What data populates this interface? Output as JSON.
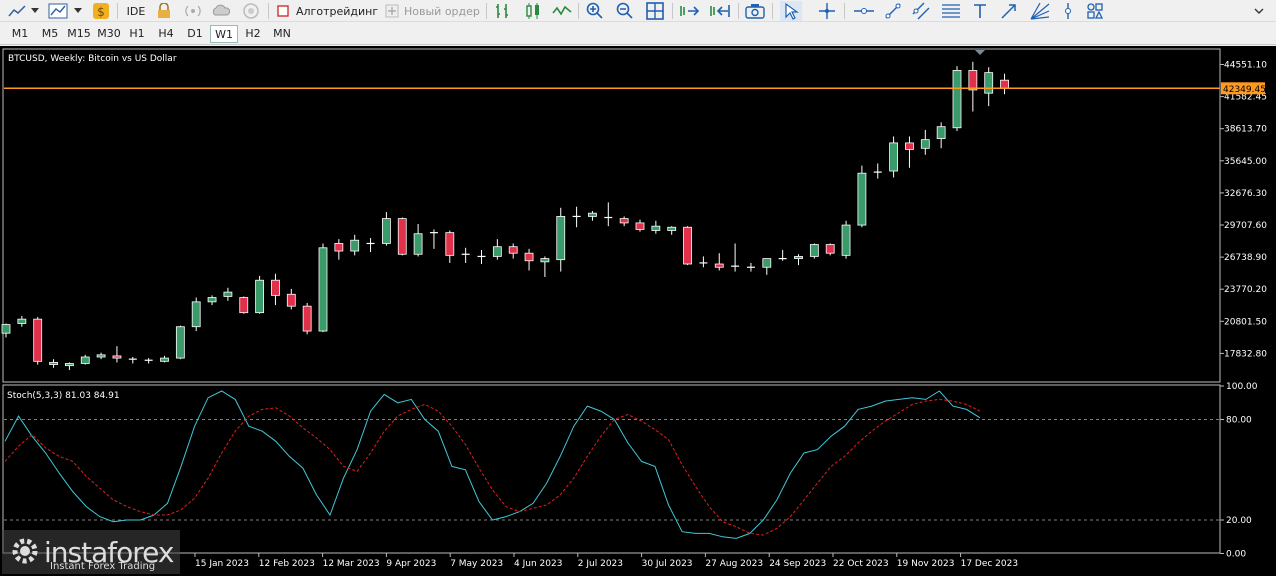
{
  "toolbar": {
    "ide_label": "IDE",
    "algotrading_label": "Алготрейдинг",
    "new_order_label": "Новый ордер"
  },
  "timeframes": [
    {
      "label": "M1",
      "active": false
    },
    {
      "label": "M5",
      "active": false
    },
    {
      "label": "M15",
      "active": false
    },
    {
      "label": "M30",
      "active": false
    },
    {
      "label": "H1",
      "active": false
    },
    {
      "label": "H4",
      "active": false
    },
    {
      "label": "D1",
      "active": false
    },
    {
      "label": "W1",
      "active": true
    },
    {
      "label": "H2",
      "active": false
    },
    {
      "label": "MN",
      "active": false
    }
  ],
  "main_chart": {
    "title": "BTCUSD, Weekly:  Bitcoin vs US Dollar",
    "current_price": "42349.45",
    "current_price_value": 42349.45,
    "price_labels": [
      "44551.10",
      "41582.45",
      "38613.70",
      "35645.00",
      "32676.30",
      "29707.60",
      "26738.90",
      "23770.20",
      "20801.50",
      "17832.80"
    ],
    "colors": {
      "bull": "#3a9a6a",
      "bear": "#e0304a",
      "price_line": "#ff9a20",
      "background": "#000000"
    }
  },
  "indicator": {
    "title": "Stoch(5,3,3) 81.03 84.91",
    "levels": [
      "100.00",
      "80.00",
      "20.00",
      "0.00"
    ],
    "colors": {
      "k_line": "#40c8d8",
      "d_line": "#e02020"
    }
  },
  "time_labels": [
    "15 Jan 2023",
    "12 Feb 2023",
    "12 Mar 2023",
    "9 Apr 2023",
    "7 May 2023",
    "4 Jun 2023",
    "2 Jul 2023",
    "30 Jul 2023",
    "27 Aug 2023",
    "24 Sep 2023",
    "22 Oct 2023",
    "19 Nov 2023",
    "17 Dec 2023"
  ],
  "watermark": {
    "brand": "instaforex",
    "tagline": "Instant Forex Trading"
  },
  "chart_data": {
    "type": "candlestick",
    "title": "BTCUSD, Weekly:  Bitcoin vs US Dollar",
    "series": [
      {
        "name": "BTCUSD",
        "candles": [
          {
            "o": 19700,
            "h": 20600,
            "l": 19300,
            "c": 20500
          },
          {
            "o": 20600,
            "h": 21300,
            "l": 20300,
            "c": 21000
          },
          {
            "o": 21000,
            "h": 21200,
            "l": 16800,
            "c": 17100
          },
          {
            "o": 16800,
            "h": 17300,
            "l": 16500,
            "c": 17000
          },
          {
            "o": 16700,
            "h": 17000,
            "l": 16300,
            "c": 16900
          },
          {
            "o": 16900,
            "h": 17700,
            "l": 16800,
            "c": 17500
          },
          {
            "o": 17500,
            "h": 17900,
            "l": 17300,
            "c": 17700
          },
          {
            "o": 17600,
            "h": 18500,
            "l": 17000,
            "c": 17400
          },
          {
            "o": 17200,
            "h": 17500,
            "l": 16900,
            "c": 17300
          },
          {
            "o": 17200,
            "h": 17400,
            "l": 16900,
            "c": 17100
          },
          {
            "o": 17100,
            "h": 17600,
            "l": 17000,
            "c": 17400
          },
          {
            "o": 17400,
            "h": 20400,
            "l": 17300,
            "c": 20300
          },
          {
            "o": 20300,
            "h": 23000,
            "l": 19900,
            "c": 22600
          },
          {
            "o": 22600,
            "h": 23200,
            "l": 22300,
            "c": 23000
          },
          {
            "o": 23100,
            "h": 23900,
            "l": 22700,
            "c": 23500
          },
          {
            "o": 23000,
            "h": 23100,
            "l": 21500,
            "c": 21600
          },
          {
            "o": 21600,
            "h": 25000,
            "l": 21500,
            "c": 24600
          },
          {
            "o": 24600,
            "h": 25200,
            "l": 22300,
            "c": 23200
          },
          {
            "o": 23300,
            "h": 23800,
            "l": 21900,
            "c": 22200
          },
          {
            "o": 22200,
            "h": 22500,
            "l": 19600,
            "c": 19900
          },
          {
            "o": 19900,
            "h": 28000,
            "l": 19800,
            "c": 27600
          },
          {
            "o": 28000,
            "h": 28400,
            "l": 26500,
            "c": 27300
          },
          {
            "o": 27300,
            "h": 28800,
            "l": 26900,
            "c": 28300
          },
          {
            "o": 27900,
            "h": 28500,
            "l": 27200,
            "c": 28000
          },
          {
            "o": 28000,
            "h": 30900,
            "l": 27800,
            "c": 30300
          },
          {
            "o": 30300,
            "h": 30400,
            "l": 26900,
            "c": 27000
          },
          {
            "o": 27000,
            "h": 29800,
            "l": 26800,
            "c": 28900
          },
          {
            "o": 28900,
            "h": 29300,
            "l": 27500,
            "c": 29000
          },
          {
            "o": 29000,
            "h": 29200,
            "l": 26200,
            "c": 26900
          },
          {
            "o": 26900,
            "h": 27600,
            "l": 26200,
            "c": 27000
          },
          {
            "o": 26700,
            "h": 27400,
            "l": 26100,
            "c": 26800
          },
          {
            "o": 26800,
            "h": 28400,
            "l": 26500,
            "c": 27700
          },
          {
            "o": 27700,
            "h": 28000,
            "l": 26600,
            "c": 27100
          },
          {
            "o": 27100,
            "h": 27500,
            "l": 25500,
            "c": 26400
          },
          {
            "o": 26300,
            "h": 26800,
            "l": 24900,
            "c": 26600
          },
          {
            "o": 26500,
            "h": 31300,
            "l": 25400,
            "c": 30500
          },
          {
            "o": 30500,
            "h": 31400,
            "l": 29500,
            "c": 30500
          },
          {
            "o": 30500,
            "h": 31000,
            "l": 30100,
            "c": 30800
          },
          {
            "o": 30400,
            "h": 31800,
            "l": 29600,
            "c": 30300
          },
          {
            "o": 30300,
            "h": 30500,
            "l": 29600,
            "c": 29900
          },
          {
            "o": 29900,
            "h": 30200,
            "l": 29100,
            "c": 29300
          },
          {
            "o": 29200,
            "h": 30100,
            "l": 28900,
            "c": 29600
          },
          {
            "o": 29200,
            "h": 29600,
            "l": 28800,
            "c": 29500
          },
          {
            "o": 29500,
            "h": 29600,
            "l": 26000,
            "c": 26100
          },
          {
            "o": 26100,
            "h": 26800,
            "l": 25800,
            "c": 26200
          },
          {
            "o": 26100,
            "h": 27100,
            "l": 25500,
            "c": 25800
          },
          {
            "o": 25800,
            "h": 28000,
            "l": 25400,
            "c": 25900
          },
          {
            "o": 25700,
            "h": 26200,
            "l": 25400,
            "c": 25800
          },
          {
            "o": 25800,
            "h": 26600,
            "l": 25100,
            "c": 26600
          },
          {
            "o": 26500,
            "h": 27400,
            "l": 26400,
            "c": 26600
          },
          {
            "o": 26600,
            "h": 27000,
            "l": 26000,
            "c": 26800
          },
          {
            "o": 26800,
            "h": 28000,
            "l": 26600,
            "c": 27900
          },
          {
            "o": 27900,
            "h": 28000,
            "l": 26900,
            "c": 27100
          },
          {
            "o": 26900,
            "h": 30100,
            "l": 26600,
            "c": 29700
          },
          {
            "o": 29700,
            "h": 35200,
            "l": 29500,
            "c": 34500
          },
          {
            "o": 34500,
            "h": 35400,
            "l": 34000,
            "c": 34600
          },
          {
            "o": 34700,
            "h": 37900,
            "l": 34100,
            "c": 37300
          },
          {
            "o": 37300,
            "h": 37900,
            "l": 35000,
            "c": 36700
          },
          {
            "o": 36800,
            "h": 38500,
            "l": 36200,
            "c": 37600
          },
          {
            "o": 37700,
            "h": 39200,
            "l": 36800,
            "c": 38800
          },
          {
            "o": 38700,
            "h": 44400,
            "l": 38400,
            "c": 44000
          },
          {
            "o": 44000,
            "h": 44800,
            "l": 40200,
            "c": 42200
          },
          {
            "o": 41900,
            "h": 44300,
            "l": 40700,
            "c": 43800
          },
          {
            "o": 43100,
            "h": 43700,
            "l": 41800,
            "c": 42349.45
          }
        ]
      }
    ],
    "stochastic": {
      "name": "Stoch(5,3,3)",
      "k_last": 81.03,
      "d_last": 84.91,
      "levels": [
        20,
        80
      ],
      "ylim": [
        0,
        100
      ],
      "k": [
        67,
        82,
        70,
        60,
        48,
        37,
        28,
        22,
        19,
        20,
        20,
        23,
        30,
        52,
        76,
        93,
        97,
        92,
        76,
        73,
        67,
        58,
        51,
        35,
        23,
        45,
        62,
        85,
        95,
        90,
        92,
        80,
        73,
        52,
        50,
        31,
        20,
        22,
        25,
        30,
        42,
        58,
        76,
        88,
        85,
        80,
        66,
        55,
        52,
        29,
        13,
        12,
        12,
        10,
        9,
        12,
        20,
        32,
        48,
        60,
        62,
        70,
        76,
        86,
        88,
        91,
        92,
        93,
        92,
        97,
        88,
        86,
        81
      ],
      "d": [
        55,
        64,
        71,
        63,
        58,
        55,
        46,
        39,
        32,
        28,
        25,
        23,
        23,
        26,
        33,
        45,
        60,
        73,
        82,
        86,
        87,
        82,
        75,
        69,
        62,
        52,
        49,
        60,
        73,
        82,
        86,
        89,
        85,
        76,
        65,
        51,
        38,
        28,
        25,
        27,
        29,
        35,
        45,
        58,
        70,
        80,
        83,
        79,
        74,
        68,
        53,
        40,
        28,
        19,
        16,
        12,
        11,
        15,
        22,
        32,
        42,
        52,
        58,
        66,
        73,
        79,
        84,
        89,
        91,
        92,
        91,
        89,
        85
      ]
    }
  }
}
